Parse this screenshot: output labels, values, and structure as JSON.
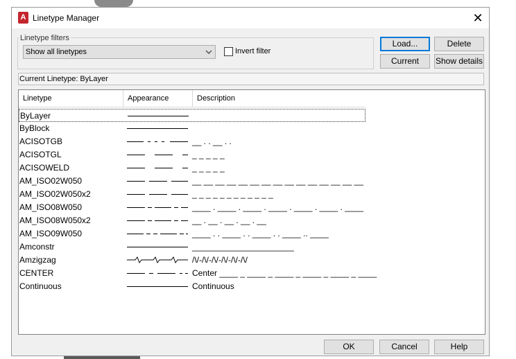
{
  "window": {
    "title": "Linetype Manager",
    "close_glyph": "✕",
    "icon": "autocad-app-icon"
  },
  "filters": {
    "group_label": "Linetype filters",
    "selected": "Show all linetypes",
    "invert_label": "Invert filter",
    "invert_checked": false
  },
  "buttons": {
    "load": "Load...",
    "delete": "Delete",
    "current": "Current",
    "show_details": "Show details",
    "ok": "OK",
    "cancel": "Cancel",
    "help": "Help"
  },
  "current_linetype": "Current Linetype:  ByLayer",
  "columns": {
    "linetype": "Linetype",
    "appearance": "Appearance",
    "description": "Description"
  },
  "rows": [
    {
      "name": "ByLayer",
      "pattern": "solid",
      "description": "",
      "selected": true
    },
    {
      "name": "ByBlock",
      "pattern": "solid",
      "description": ""
    },
    {
      "name": "ACISOTGB",
      "pattern": "dashdotdot",
      "description": "__ . . __ . ."
    },
    {
      "name": "ACISOTGL",
      "pattern": "longgap",
      "description": "_ _ _ _ _"
    },
    {
      "name": "ACISOWELD",
      "pattern": "longgap",
      "description": "_ _ _ _ _"
    },
    {
      "name": "AM_ISO02W050",
      "pattern": "dashed",
      "description": "__ __ __ __ __ __ __ __ __ __ __ __ __ __ __"
    },
    {
      "name": "AM_ISO02W050x2",
      "pattern": "dashed",
      "description": "_ _ _ _ _ _ _ _ _ _ _ _"
    },
    {
      "name": "AM_ISO08W050",
      "pattern": "longshort",
      "description": "____ . ____ . ____ . ____ . ____ . ____ . ____"
    },
    {
      "name": "AM_ISO08W050x2",
      "pattern": "longshort",
      "description": "__ . __ . __ . __ . __"
    },
    {
      "name": "AM_ISO09W050",
      "pattern": "longshortshort",
      "description": "____ . . ____ . . ____ . . ____ .. ____"
    },
    {
      "name": "Amconstr",
      "pattern": "solid",
      "description": "______________________"
    },
    {
      "name": "Amzigzag",
      "pattern": "zigzag",
      "description": "/\\/-/\\/-/\\/-/\\/-/\\/-/\\/"
    },
    {
      "name": "CENTER",
      "pattern": "center",
      "description": "Center ____ _ ____ _ ____ _ ____ _ ____ _ ____"
    },
    {
      "name": "Continuous",
      "pattern": "solid",
      "description": "Continuous"
    }
  ]
}
